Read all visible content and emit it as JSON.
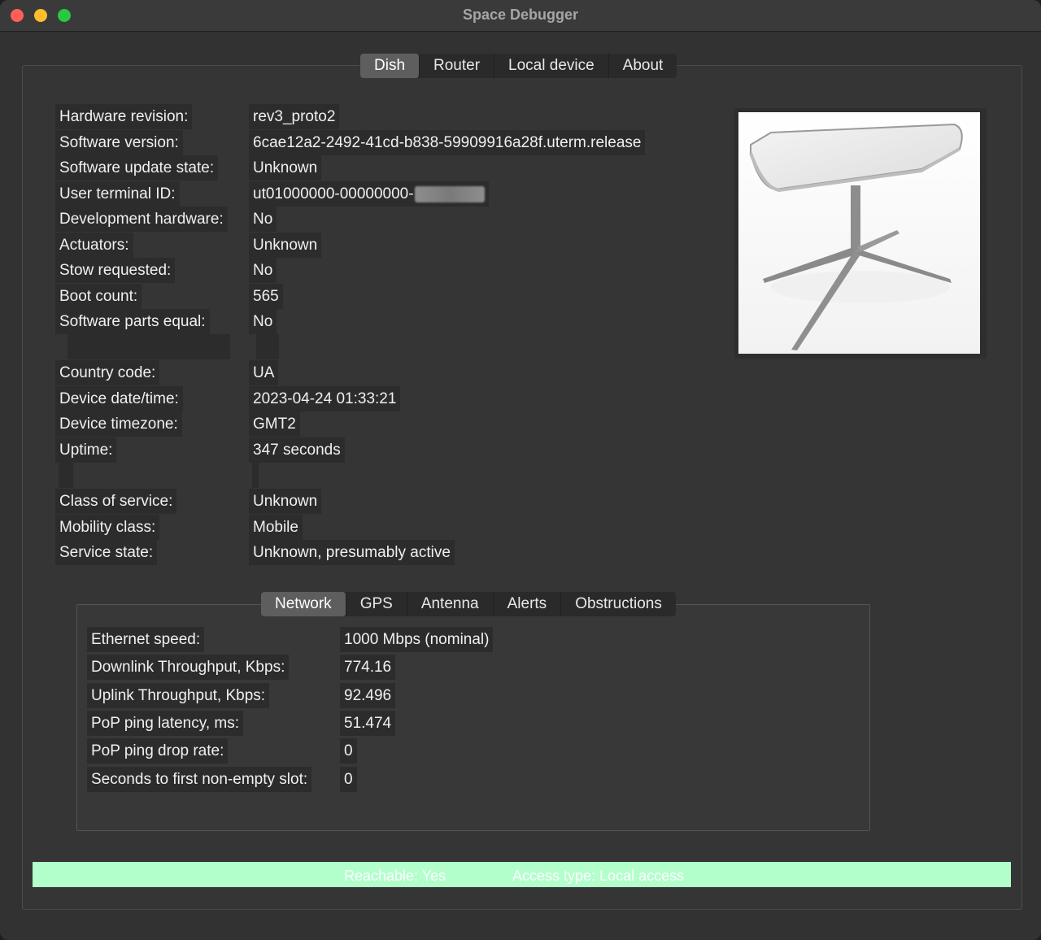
{
  "window": {
    "title": "Space Debugger"
  },
  "main_tabs": [
    "Dish",
    "Router",
    "Local device",
    "About"
  ],
  "dish": {
    "hardware_revision": {
      "label": "Hardware revision:",
      "value": "rev3_proto2"
    },
    "software_version": {
      "label": "Software version:",
      "value": "6cae12a2-2492-41cd-b838-59909916a28f.uterm.release"
    },
    "software_update_state": {
      "label": "Software update state:",
      "value": "Unknown"
    },
    "user_terminal_id": {
      "label": "User terminal ID:",
      "value": "ut01000000-00000000-"
    },
    "development_hardware": {
      "label": "Development hardware:",
      "value": "No"
    },
    "actuators": {
      "label": "Actuators:",
      "value": "Unknown"
    },
    "stow_requested": {
      "label": "Stow requested:",
      "value": "No"
    },
    "boot_count": {
      "label": "Boot count:",
      "value": "565"
    },
    "software_parts_equal": {
      "label": "Software parts equal:",
      "value": "No"
    },
    "country_code": {
      "label": "Country code:",
      "value": "UA"
    },
    "device_datetime": {
      "label": "Device date/time:",
      "value": "2023-04-24 01:33:21"
    },
    "device_timezone": {
      "label": "Device timezone:",
      "value": "GMT2"
    },
    "uptime": {
      "label": "Uptime:",
      "value": "347 seconds"
    },
    "class_of_service": {
      "label": "Class of service:",
      "value": "Unknown"
    },
    "mobility_class": {
      "label": "Mobility class:",
      "value": "Mobile"
    },
    "service_state": {
      "label": "Service state:",
      "value": "Unknown, presumably active"
    }
  },
  "sub_tabs": [
    "Network",
    "GPS",
    "Antenna",
    "Alerts",
    "Obstructions"
  ],
  "network": {
    "ethernet_speed": {
      "label": "Ethernet speed:",
      "value": "1000 Mbps (nominal)"
    },
    "downlink": {
      "label": "Downlink Throughput, Kbps:",
      "value": "774.16"
    },
    "uplink": {
      "label": "Uplink Throughput, Kbps:",
      "value": "92.496"
    },
    "pop_latency": {
      "label": "PoP ping latency, ms:",
      "value": "51.474"
    },
    "pop_drop": {
      "label": "PoP ping drop rate:",
      "value": "0"
    },
    "first_slot": {
      "label": "Seconds to first non-empty slot:",
      "value": "0"
    }
  },
  "status": {
    "reachable": "Reachable: Yes",
    "access_type": "Access type: Local access",
    "color": "#b3ffcc"
  }
}
